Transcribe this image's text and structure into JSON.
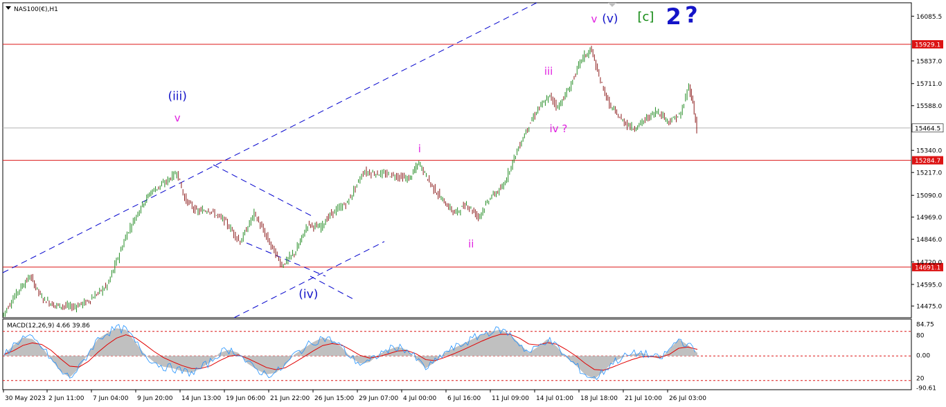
{
  "chart_window": {
    "title": "NAS100(€),H1",
    "indicator_label": "MACD(12,26,9) 4.66 39.86"
  },
  "colors": {
    "up_candle": "#228b22",
    "down_candle": "#8b1a1a",
    "channel_line": "#0000cd",
    "hline": "#dc1414",
    "macd_hist": "#c0c0c0",
    "macd_line": "#1e90ff",
    "signal_line": "#e00000",
    "wave_magenta": "#e020e0",
    "wave_blue": "#1414c8",
    "wave_green": "#138a13"
  },
  "chart_data": [
    {
      "type": "line",
      "title": "NAS100(€),H1",
      "ylim": [
        14410,
        16160
      ],
      "price_axis_ticks": [
        "16085.5",
        "15837.0",
        "15711.0",
        "15588.0",
        "15340.0",
        "15217.0",
        "15090.0",
        "14969.0",
        "14846.0",
        "14720.0",
        "14595.0",
        "14475.0"
      ],
      "time_axis_ticks": [
        "30 May 2023",
        "2 Jun 11:00",
        "7 Jun 04:00",
        "9 Jun 20:00",
        "14 Jun 13:00",
        "19 Jun 06:00",
        "21 Jun 22:00",
        "26 Jun 15:00",
        "29 Jun 07:00",
        "4 Jul 00:00",
        "6 Jul 16:00",
        "11 Jul 09:00",
        "14 Jul 01:00",
        "18 Jul 18:00",
        "21 Jul 10:00",
        "26 Jul 03:00"
      ],
      "horizontal_levels": [
        {
          "label": "15929.1",
          "value": 15929.1,
          "color": "#dc1414"
        },
        {
          "label": "15284.7",
          "value": 15284.7,
          "color": "#dc1414"
        },
        {
          "label": "14691.1",
          "value": 14691.1,
          "color": "#dc1414"
        },
        {
          "label": "15464.5",
          "value": 15464.5,
          "color": "#b0b0b0",
          "current": true
        }
      ],
      "price_path": [
        {
          "x": 0,
          "y": 14420
        },
        {
          "x": 8,
          "y": 14560
        },
        {
          "x": 14,
          "y": 14640
        },
        {
          "x": 20,
          "y": 14520
        },
        {
          "x": 26,
          "y": 14480
        },
        {
          "x": 36,
          "y": 14470
        },
        {
          "x": 43,
          "y": 14500
        },
        {
          "x": 53,
          "y": 14590
        },
        {
          "x": 63,
          "y": 14880
        },
        {
          "x": 70,
          "y": 15030
        },
        {
          "x": 75,
          "y": 15110
        },
        {
          "x": 82,
          "y": 15160
        },
        {
          "x": 88,
          "y": 15220
        },
        {
          "x": 92,
          "y": 15070
        },
        {
          "x": 98,
          "y": 15000
        },
        {
          "x": 104,
          "y": 15010
        },
        {
          "x": 112,
          "y": 14950
        },
        {
          "x": 120,
          "y": 14830
        },
        {
          "x": 127,
          "y": 14990
        },
        {
          "x": 134,
          "y": 14840
        },
        {
          "x": 141,
          "y": 14700
        },
        {
          "x": 148,
          "y": 14780
        },
        {
          "x": 154,
          "y": 14930
        },
        {
          "x": 160,
          "y": 14910
        },
        {
          "x": 166,
          "y": 14990
        },
        {
          "x": 174,
          "y": 15050
        },
        {
          "x": 182,
          "y": 15220
        },
        {
          "x": 190,
          "y": 15210
        },
        {
          "x": 198,
          "y": 15200
        },
        {
          "x": 205,
          "y": 15180
        },
        {
          "x": 210,
          "y": 15270
        },
        {
          "x": 216,
          "y": 15150
        },
        {
          "x": 222,
          "y": 15060
        },
        {
          "x": 228,
          "y": 14990
        },
        {
          "x": 234,
          "y": 15040
        },
        {
          "x": 240,
          "y": 14970
        },
        {
          "x": 246,
          "y": 15080
        },
        {
          "x": 252,
          "y": 15130
        },
        {
          "x": 258,
          "y": 15300
        },
        {
          "x": 264,
          "y": 15450
        },
        {
          "x": 270,
          "y": 15570
        },
        {
          "x": 276,
          "y": 15640
        },
        {
          "x": 280,
          "y": 15580
        },
        {
          "x": 286,
          "y": 15690
        },
        {
          "x": 292,
          "y": 15850
        },
        {
          "x": 297,
          "y": 15900
        },
        {
          "x": 300,
          "y": 15770
        },
        {
          "x": 306,
          "y": 15590
        },
        {
          "x": 312,
          "y": 15510
        },
        {
          "x": 318,
          "y": 15460
        },
        {
          "x": 324,
          "y": 15510
        },
        {
          "x": 330,
          "y": 15560
        },
        {
          "x": 336,
          "y": 15500
        },
        {
          "x": 342,
          "y": 15540
        },
        {
          "x": 346,
          "y": 15700
        },
        {
          "x": 348,
          "y": 15600
        },
        {
          "x": 350,
          "y": 15460
        }
      ],
      "price_path_x_range": [
        0,
        350
      ]
    },
    {
      "type": "bar",
      "title": "MACD(12,26,9) 4.66 39.86",
      "ylim": [
        -110,
        120
      ],
      "axis_ticks": [
        "84.75",
        "80",
        "0.00",
        "-90.61",
        "20"
      ],
      "reference_levels": [
        80,
        0,
        -80
      ],
      "histogram": [
        5,
        35,
        60,
        55,
        30,
        -10,
        -50,
        -70,
        -40,
        10,
        55,
        75,
        90,
        85,
        45,
        5,
        -20,
        -35,
        -40,
        -50,
        -55,
        -40,
        -20,
        10,
        20,
        10,
        -25,
        -45,
        -60,
        -55,
        -30,
        5,
        25,
        45,
        60,
        50,
        30,
        -5,
        -25,
        -20,
        5,
        20,
        30,
        20,
        -10,
        -40,
        -20,
        10,
        25,
        40,
        55,
        70,
        80,
        85,
        70,
        40,
        10,
        30,
        55,
        30,
        -5,
        -30,
        -60,
        -75,
        -50,
        -20,
        -5,
        5,
        10,
        0,
        -10,
        20,
        55,
        35,
        10
      ]
    }
  ],
  "wave_labels": [
    {
      "text": "(iii)",
      "color": "#1414c8",
      "size": 17,
      "price": 15620,
      "xi": 88
    },
    {
      "text": "v",
      "color": "#e020e0",
      "size": 15,
      "price": 15500,
      "xi": 88
    },
    {
      "text": "i",
      "color": "#e020e0",
      "size": 15,
      "price": 15330,
      "xi": 210
    },
    {
      "text": "ii",
      "color": "#e020e0",
      "size": 15,
      "price": 14800,
      "xi": 236
    },
    {
      "text": "iii",
      "color": "#e020e0",
      "size": 15,
      "price": 15760,
      "xi": 275
    },
    {
      "text": "iv ?",
      "color": "#e020e0",
      "size": 15,
      "price": 15440,
      "xi": 280
    },
    {
      "text": "v",
      "color": "#e020e0",
      "size": 15,
      "price": 16050,
      "xi": 298
    },
    {
      "text": "(v)",
      "color": "#1414c8",
      "size": 17,
      "price": 16050,
      "xi": 306
    },
    {
      "text": "[c]",
      "color": "#138a13",
      "size": 18,
      "price": 16060,
      "xi": 324
    },
    {
      "text": "2",
      "color": "#1414c8",
      "size": 32,
      "price": 16040,
      "xi": 338
    },
    {
      "text": "?",
      "color": "#1414c8",
      "size": 32,
      "price": 16050,
      "xi": 347
    },
    {
      "text": "(iv)",
      "color": "#1414c8",
      "size": 17,
      "price": 14520,
      "xi": 154
    }
  ]
}
